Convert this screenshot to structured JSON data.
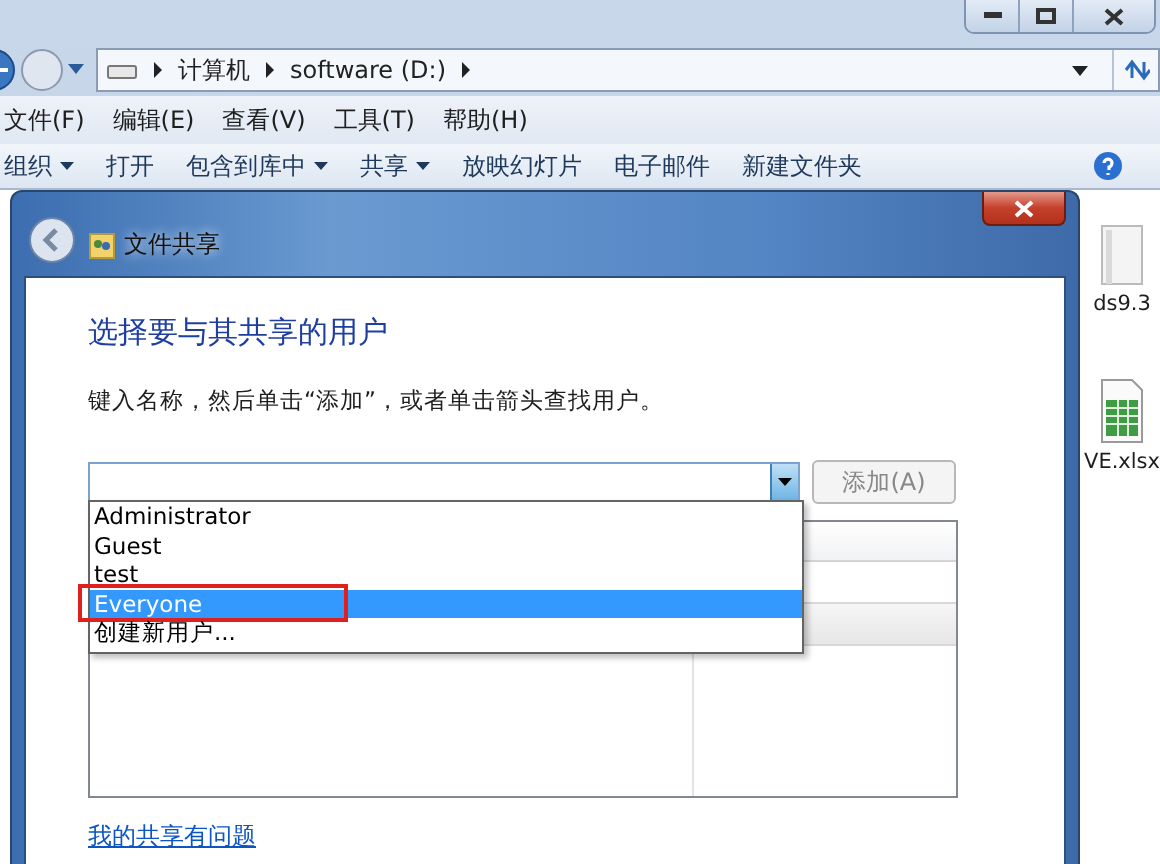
{
  "explorer": {
    "address_path": [
      "计算机",
      "software (D:)"
    ],
    "menu": [
      "文件(F)",
      "编辑(E)",
      "查看(V)",
      "工具(T)",
      "帮助(H)"
    ],
    "toolbar": [
      {
        "label": "组织",
        "dropdown": true
      },
      {
        "label": "打开",
        "dropdown": false
      },
      {
        "label": "包含到库中",
        "dropdown": true
      },
      {
        "label": "共享",
        "dropdown": true
      },
      {
        "label": "放映幻灯片",
        "dropdown": false
      },
      {
        "label": "电子邮件",
        "dropdown": false
      },
      {
        "label": "新建文件夹",
        "dropdown": false
      }
    ],
    "files": [
      {
        "name": "ds9.3",
        "kind": "folder"
      },
      {
        "name": "VE.xlsx",
        "kind": "sheet"
      }
    ]
  },
  "dialog": {
    "title": "文件共享",
    "heading": "选择要与其共享的用户",
    "instruction": "键入名称，然后单击“添加”，或者单击箭头查找用户。",
    "add_button": {
      "label": "添加(A)",
      "disabled": true
    },
    "dropdown": {
      "expanded": true,
      "items": [
        {
          "label": "Administrator",
          "selected": false,
          "highlighted": false
        },
        {
          "label": "Guest",
          "selected": false,
          "highlighted": false
        },
        {
          "label": "test",
          "selected": false,
          "highlighted": false
        },
        {
          "label": "Everyone",
          "selected": true,
          "highlighted": true
        },
        {
          "label": "创建新用户...",
          "selected": false,
          "highlighted": false
        }
      ]
    },
    "link": "我的共享有问题"
  }
}
